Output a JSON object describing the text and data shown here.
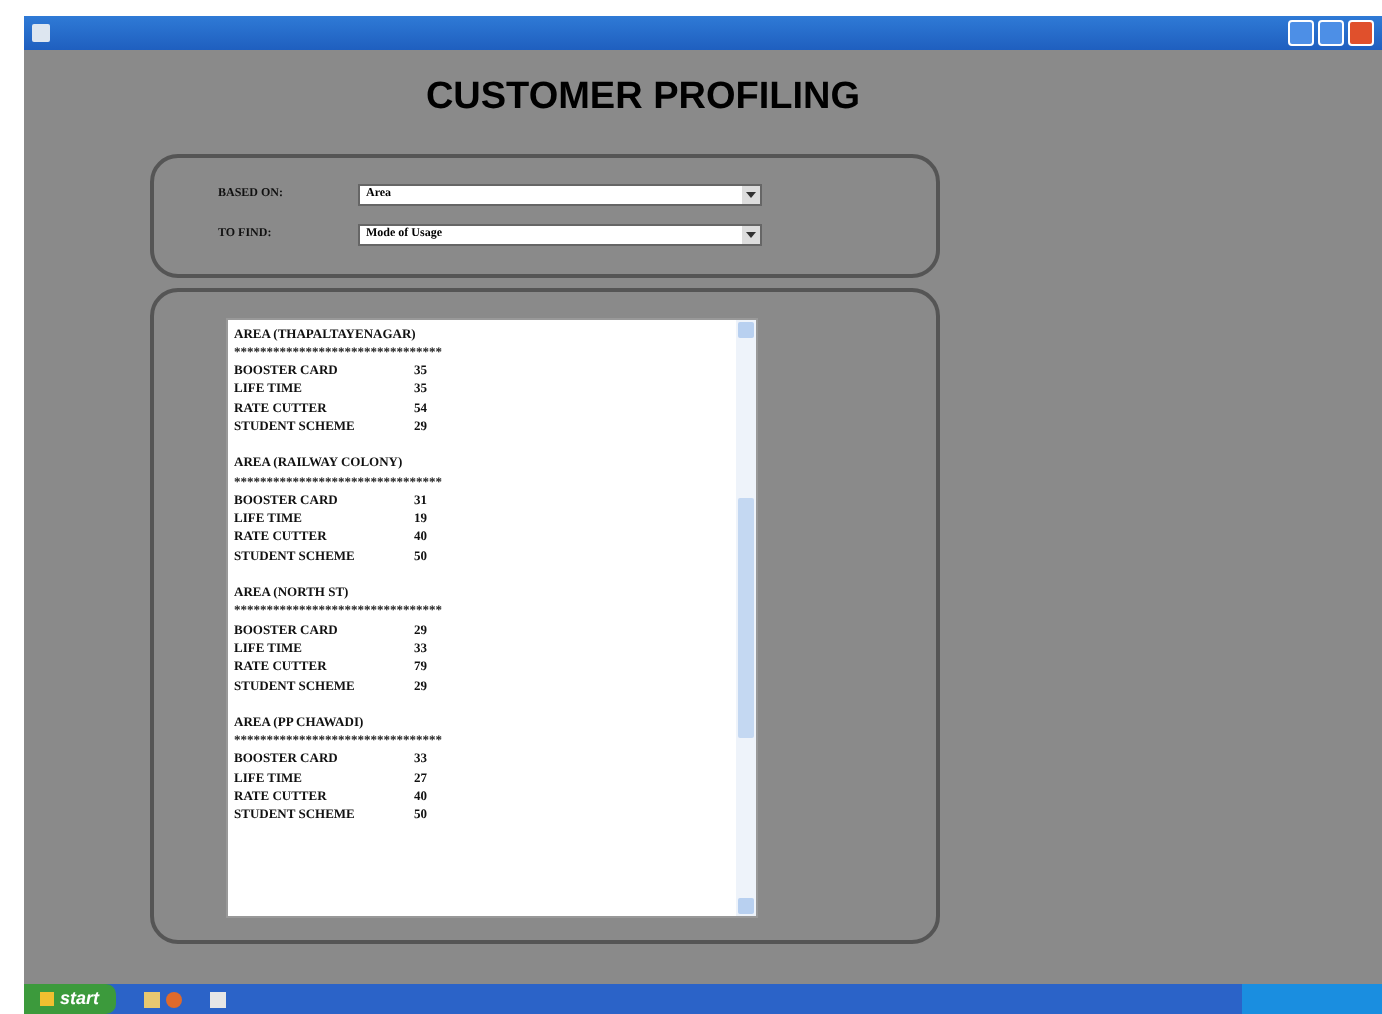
{
  "title": "CUSTOMER PROFILING",
  "filters": [
    {
      "label": "BASED ON:",
      "value": "Area"
    },
    {
      "label": "TO FIND:",
      "value": "Mode of Usage"
    }
  ],
  "report": {
    "sections": [
      {
        "heading": "AREA (THAPALTAYENAGAR)",
        "separator": "********************************",
        "rows": [
          {
            "label": "BOOSTER CARD",
            "value": "35"
          },
          {
            "label": "LIFE TIME",
            "value": "35"
          },
          {
            "label": "RATE CUTTER",
            "value": "54"
          },
          {
            "label": "STUDENT SCHEME",
            "value": "29"
          }
        ]
      },
      {
        "heading": "AREA (RAILWAY COLONY)",
        "separator": "********************************",
        "rows": [
          {
            "label": "BOOSTER CARD",
            "value": "31"
          },
          {
            "label": "LIFE TIME",
            "value": "19"
          },
          {
            "label": "RATE CUTTER",
            "value": "40"
          },
          {
            "label": "STUDENT SCHEME",
            "value": "50"
          }
        ]
      },
      {
        "heading": "AREA (NORTH ST)",
        "separator": "********************************",
        "rows": [
          {
            "label": "BOOSTER CARD",
            "value": "29"
          },
          {
            "label": "LIFE TIME",
            "value": "33"
          },
          {
            "label": "RATE CUTTER",
            "value": "79"
          },
          {
            "label": "STUDENT SCHEME",
            "value": "29"
          }
        ]
      },
      {
        "heading": "AREA (PP CHAWADI)",
        "separator": "********************************",
        "rows": [
          {
            "label": "BOOSTER CARD",
            "value": "33"
          },
          {
            "label": "LIFE TIME",
            "value": "27"
          },
          {
            "label": "RATE CUTTER",
            "value": "40"
          },
          {
            "label": "STUDENT SCHEME",
            "value": "50"
          }
        ]
      }
    ]
  },
  "taskbar": {
    "start": "start"
  }
}
